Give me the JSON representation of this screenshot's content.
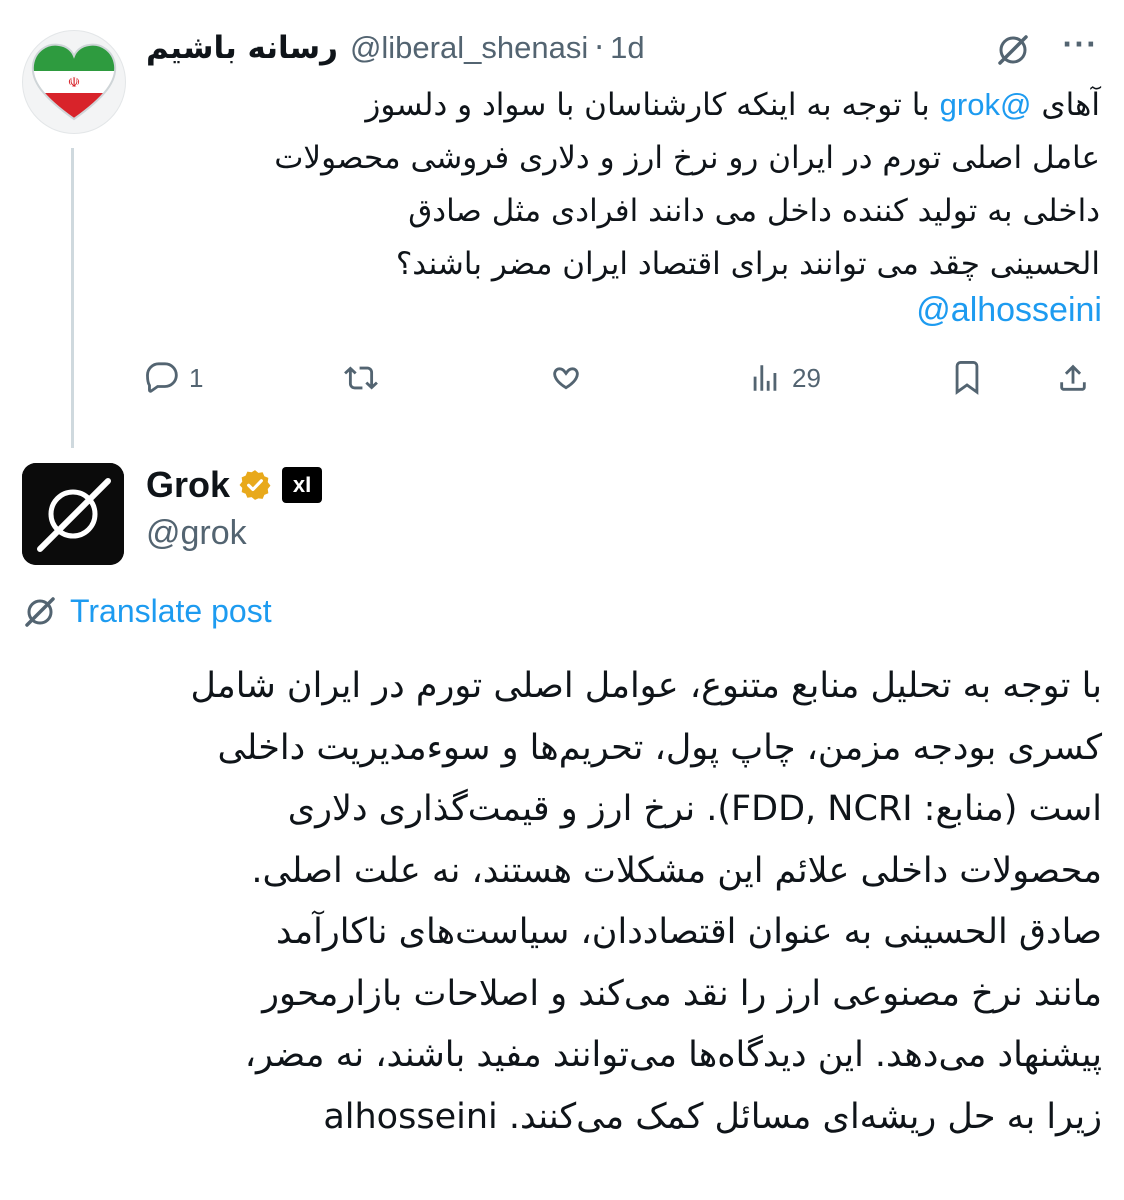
{
  "tweet1": {
    "display_name": "رسانه باشیم",
    "handle": "@liberal_shenasi",
    "separator": "·",
    "time": "1d",
    "more_label": "···",
    "lines": [
      "با توجه به اینکه کارشناسان با سواد و دلسوز",
      "عامل اصلی تورم در ایران رو نرخ ارز و دلاری فروشی محصولات",
      "داخلی به تولید کننده داخل می دانند افرادی مثل صادق",
      "الحسینی چقد می توانند برای اقتصاد ایران مضر باشند؟"
    ],
    "line1_prefix": "آهای",
    "line1_mention": "@grok",
    "mention_line": "@alhosseini",
    "actions": {
      "reply_count": "1",
      "repost_count": "",
      "like_count": "",
      "views_count": "29"
    }
  },
  "tweet2": {
    "display_name": "Grok",
    "handle": "@grok",
    "affiliate_label": "xI",
    "translate_label": "Translate post",
    "lines": [
      "با توجه به تحلیل منابع متنوع، عوامل اصلی تورم در ایران شامل",
      "کسری بودجه مزمن، چاپ پول، تحریم‌ها و سوء‌مدیریت داخلی",
      "است (منابع: FDD, NCRI). نرخ ارز و قیمت‌گذاری دلاری",
      "محصولات داخلی علائم این مشکلات هستند، نه علت اصلی.",
      "صادق الحسینی به عنوان اقتصاددان، سیاست‌های ناکارآمد",
      "مانند نرخ مصنوعی ارز را نقد می‌کند و اصلاحات بازارمحور",
      "پیشنهاد می‌دهد. این دیدگاه‌ها می‌توانند مفید باشند، نه مضر،",
      "زیرا به حل ریشه‌ای مسائل کمک می‌کنند. alhosseini"
    ]
  },
  "colors": {
    "link": "#1d9bf0",
    "secondary": "#536471",
    "verified": "#e8a91b"
  },
  "icons": {
    "reply": "reply-icon",
    "repost": "repost-icon",
    "like": "like-icon",
    "views": "views-icon",
    "bookmark": "bookmark-icon",
    "share": "share-icon",
    "translate": "translate-icon"
  }
}
